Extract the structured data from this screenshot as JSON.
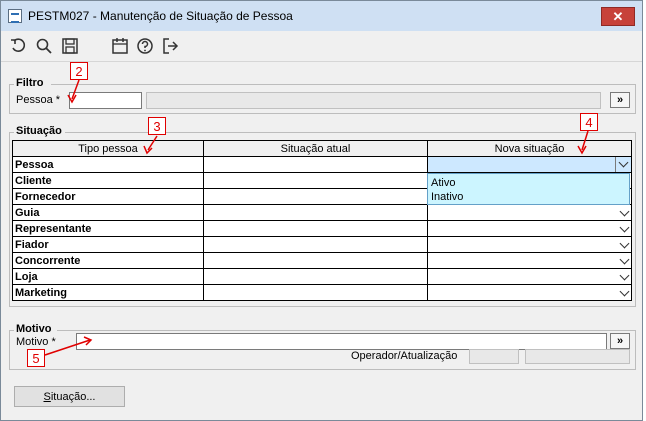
{
  "window": {
    "title": "PESTM027 - Manutenção de Situação de Pessoa",
    "close_label": "✕"
  },
  "toolbar": {
    "icons": [
      "undo-icon",
      "search-icon",
      "save-icon",
      "calendar-icon",
      "help-icon",
      "exit-icon"
    ]
  },
  "filtro": {
    "group_label": "Filtro",
    "pessoa_label": "Pessoa *",
    "pessoa_value": "",
    "pessoa_desc": "",
    "lookup_label": "»"
  },
  "situacao": {
    "group_label": "Situação",
    "columns": [
      "Tipo pessoa",
      "Situação atual",
      "Nova situação"
    ],
    "rows": [
      {
        "tipo": "Pessoa",
        "atual": "",
        "nova": ""
      },
      {
        "tipo": "Cliente",
        "atual": "",
        "nova": ""
      },
      {
        "tipo": "Fornecedor",
        "atual": "",
        "nova": ""
      },
      {
        "tipo": "Guia",
        "atual": "",
        "nova": ""
      },
      {
        "tipo": "Representante",
        "atual": "",
        "nova": ""
      },
      {
        "tipo": "Fiador",
        "atual": "",
        "nova": ""
      },
      {
        "tipo": "Concorrente",
        "atual": "",
        "nova": ""
      },
      {
        "tipo": "Loja",
        "atual": "",
        "nova": ""
      },
      {
        "tipo": "Marketing",
        "atual": "",
        "nova": ""
      }
    ],
    "dropdown_options": [
      "Ativo",
      "Inativo"
    ]
  },
  "motivo": {
    "group_label": "Motivo",
    "motivo_label": "Motivo *",
    "motivo_value": "",
    "lookup_label": "»",
    "operador_label": "Operador/Atualização"
  },
  "footer": {
    "situacao_button_u": "S",
    "situacao_button_rest": "ituação..."
  },
  "callouts": [
    "2",
    "3",
    "4",
    "5"
  ],
  "colors": {
    "callout": "#e00000",
    "dropdown_bg": "#ccf5ff",
    "titlebar": "#cfe0f3",
    "close": "#c7423a"
  }
}
